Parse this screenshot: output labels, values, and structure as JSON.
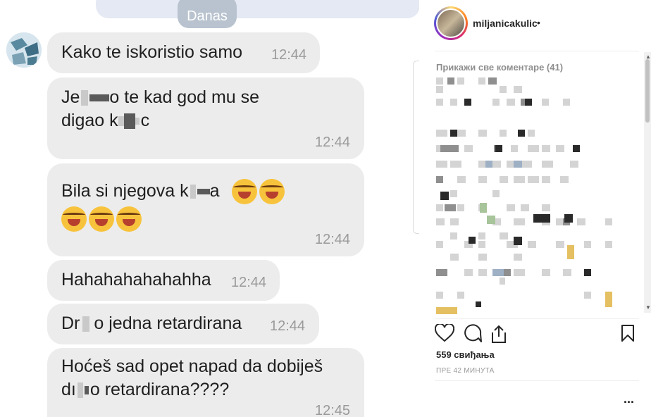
{
  "chat": {
    "date_label": "Danas",
    "messages": [
      {
        "text": "Kako te iskoristio samo",
        "time": "12:44"
      },
      {
        "line1_a": "Je",
        "line1_b": "o te kad god mu se",
        "line2_a": "digao k",
        "line2_b": "c",
        "time": "12:44"
      },
      {
        "text": "Bila si njegova k",
        "text_end": "a",
        "time": "12:44"
      },
      {
        "text": "Hahahahahahahha",
        "time": "12:44"
      },
      {
        "text_a": "Dr",
        "text_b": "o jedna retardirana",
        "time": "12:44"
      },
      {
        "line1": "Hoćeš sad opet napad da dobiješ",
        "line2_a": "dı",
        "line2_b": "o retardirana????",
        "time": "12:45"
      }
    ]
  },
  "post": {
    "username": "miljanicakulic",
    "dot": "•",
    "view_all_comments": "Прикажи све коментаре (41)",
    "likes": "559 свиђања",
    "time_ago": "ПРЕ 42 МИНУТА",
    "more": "..."
  },
  "icons": [
    "heart-icon",
    "comment-icon",
    "share-icon",
    "bookmark-icon",
    "emoji-icon",
    "scroll-up-arrow",
    "scroll-down-arrow"
  ]
}
